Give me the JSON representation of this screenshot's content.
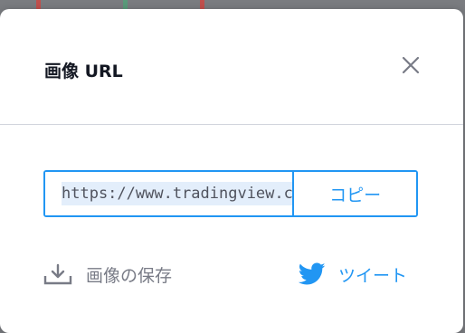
{
  "dialog": {
    "title": "画像 URL",
    "url_value": "https://www.tradingview.c",
    "copy_label": "コピー",
    "save_label": "画像の保存",
    "tweet_label": "ツイート"
  },
  "icons": {
    "close": "close-icon",
    "save": "download-icon",
    "tweet": "twitter-bird-icon"
  },
  "colors": {
    "accent": "#2196f3",
    "title_text": "#131722",
    "muted_text": "#787b86",
    "divider": "#d1d4dc",
    "overlay": "#7a7c80"
  }
}
